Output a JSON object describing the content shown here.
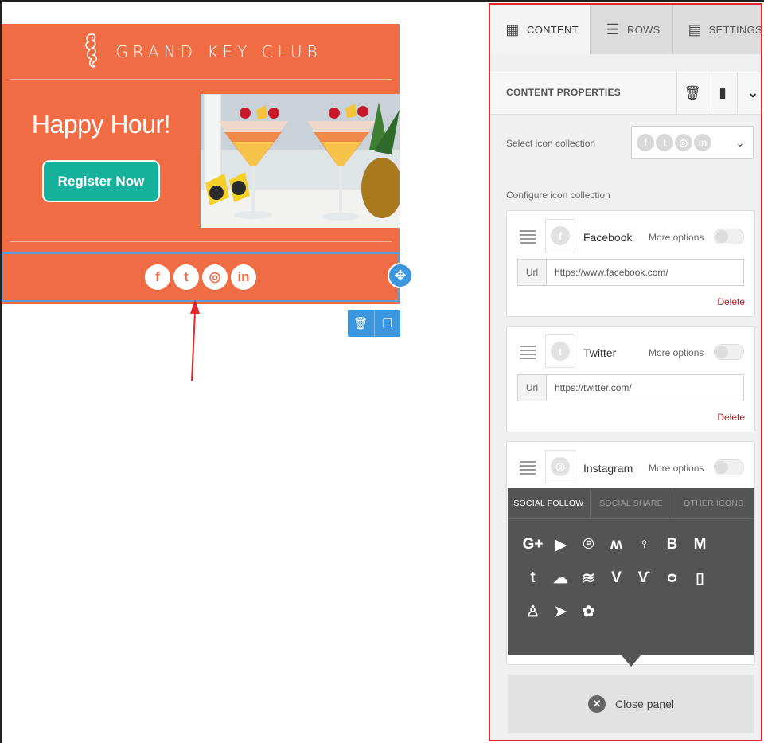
{
  "email": {
    "brand_name": "GRAND KEY CLUB",
    "hero_title": "Happy Hour!",
    "register_label": "Register Now",
    "social_icons": [
      "f",
      "t",
      "◎",
      "in"
    ],
    "accent_color": "#ef6c45",
    "button_color": "#16b19a"
  },
  "panel": {
    "tabs": [
      {
        "label": "CONTENT",
        "icon": "content-grid-icon"
      },
      {
        "label": "ROWS",
        "icon": "rows-icon"
      },
      {
        "label": "SETTINGS",
        "icon": "settings-icon"
      }
    ],
    "content_properties": "CONTENT PROPERTIES",
    "select_collection_label": "Select icon collection",
    "configure_label": "Configure icon collection",
    "more_options": "More options",
    "url_prefix": "Url",
    "delete_label": "Delete",
    "items": [
      {
        "name": "Facebook",
        "glyph": "f",
        "url": "https://www.facebook.com/"
      },
      {
        "name": "Twitter",
        "glyph": "t",
        "url": "https://twitter.com/"
      },
      {
        "name": "Instagram",
        "glyph": "◎",
        "url": ""
      }
    ],
    "popup": {
      "tabs": [
        "SOCIAL FOLLOW",
        "SOCIAL SHARE",
        "OTHER ICONS"
      ],
      "icons": [
        "G+",
        "▶",
        "℗",
        "ʍ",
        "♀",
        "B",
        "M",
        "t",
        "☁",
        "≋",
        "V",
        "Ѵ",
        "ᴑ",
        "▯",
        "♙",
        "➤",
        "✿"
      ]
    },
    "close_label": "Close panel",
    "border_color": "#e2262b"
  }
}
